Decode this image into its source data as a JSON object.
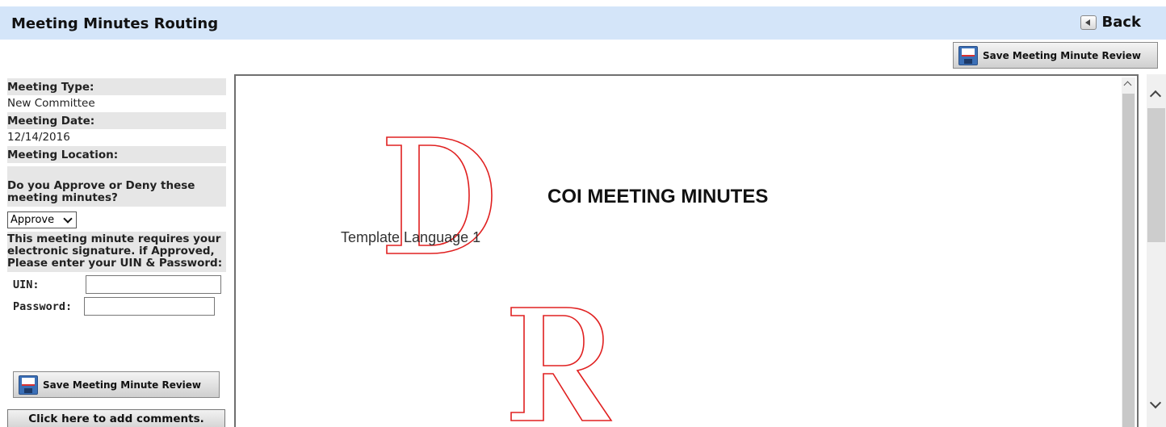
{
  "header": {
    "title": "Meeting Minutes Routing",
    "back_label": "Back"
  },
  "toolbar": {
    "save_label": "Save Meeting Minute Review"
  },
  "meeting": {
    "type_label": "Meeting Type:",
    "type_value": "New Committee",
    "date_label": "Meeting Date:",
    "date_value": "12/14/2016",
    "location_label": "Meeting Location:"
  },
  "review": {
    "question": "Do you Approve or Deny these meeting minutes?",
    "decision_selected": "Approve",
    "signature_note_1": "This meeting minute requires your electronic signature. if Approved,",
    "signature_note_2": "Please enter your UIN & Password:",
    "uin_label": "UIN:",
    "uin_value": "",
    "password_label": "Password:",
    "password_value": "",
    "save_label": "Save Meeting Minute Review",
    "comments_label": "Click here to add comments."
  },
  "document": {
    "title": "COI MEETING MINUTES",
    "template_text": "Template Language 1",
    "watermark_letters": [
      "D",
      "R"
    ],
    "watermark_color": "#e02020"
  },
  "colors": {
    "header_bg": "#d4e5f9",
    "label_bg": "#e6e6e6"
  },
  "icons": {
    "back": "back-arrow-icon",
    "save": "floppy-disk-icon"
  }
}
